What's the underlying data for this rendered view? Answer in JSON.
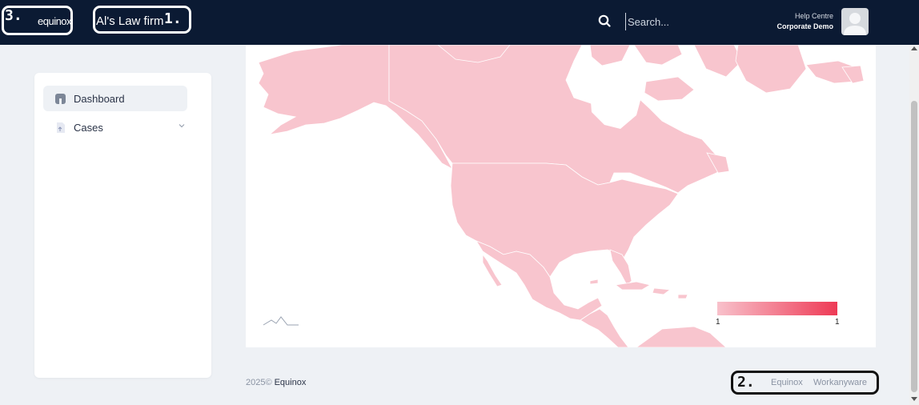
{
  "header": {
    "logo_text": "equinox",
    "firm_name": "Al's Law firm",
    "search_placeholder": "Search...",
    "help_label": "Help Centre",
    "user_name": "Corporate Demo"
  },
  "annotations": {
    "firm": "1.",
    "footer": "2.",
    "logo": "3."
  },
  "sidebar": {
    "items": [
      {
        "label": "Dashboard",
        "icon": "dashboard-icon",
        "active": true
      },
      {
        "label": "Cases",
        "icon": "document-icon",
        "active": false,
        "has_submenu": true
      }
    ]
  },
  "map": {
    "fill_color": "#f8c5ce",
    "legend_min": "1",
    "legend_max": "1",
    "legend_gradient": [
      "#f8c1cb",
      "#ee3a55"
    ]
  },
  "footer": {
    "year": "2025©",
    "brand": "Equinox",
    "links": [
      "Equinox",
      "Workanyware"
    ]
  },
  "colors": {
    "topbar": "#0b1a33",
    "background": "#eef1f5"
  }
}
